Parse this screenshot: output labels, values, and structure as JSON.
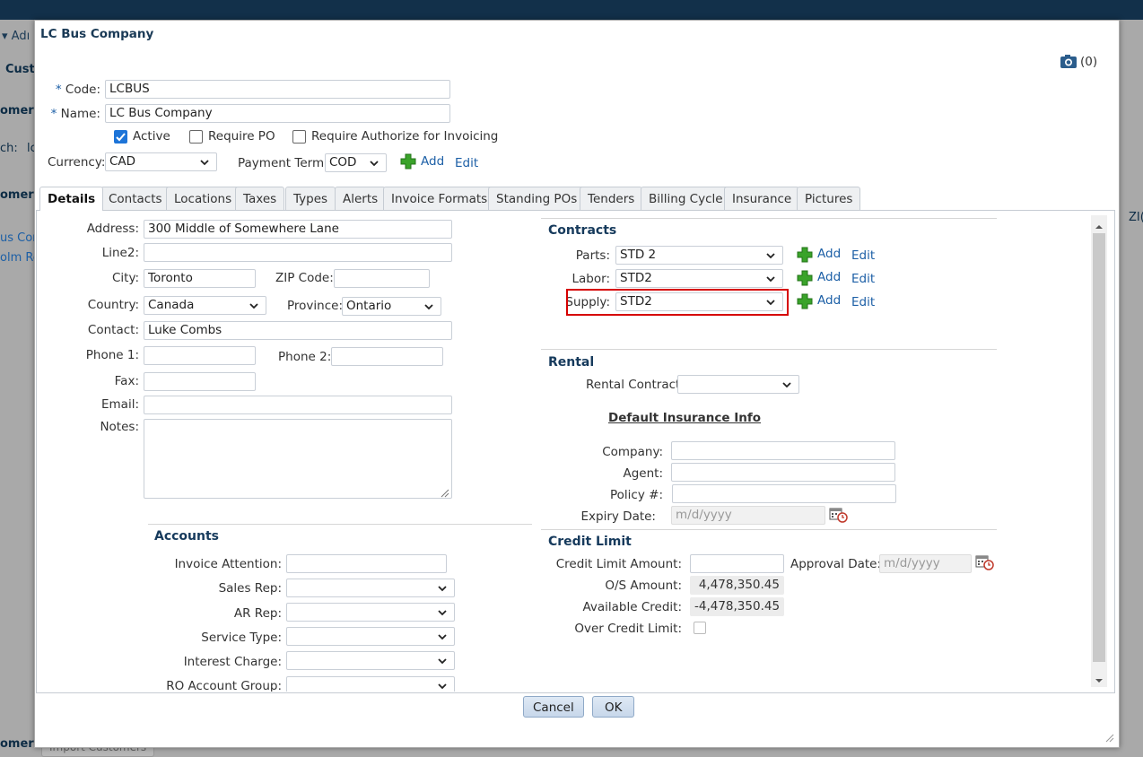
{
  "background": {
    "frag_adm": "Adı",
    "frag_cust": "Custo",
    "frag_omers": "omers",
    "frag_ch": "ch:",
    "frag_lc": "lc",
    "frag_omers2": "omers",
    "frag_zi": "ZI(",
    "frag_row1": "us Cor",
    "frag_row2": "olm Re",
    "frag_bottom": "omers",
    "import_label": "Import Customers"
  },
  "dialog": {
    "title": "LC Bus Company",
    "attachments_count": "(0)",
    "code_label": "Code:",
    "code_value": "LCBUS",
    "name_label": "Name:",
    "name_value": "LC Bus Company",
    "req_mark": "*",
    "active_label": "Active",
    "require_po_label": "Require PO",
    "require_auth_label": "Require Authorize for Invoicing",
    "currency_label": "Currency:",
    "currency_value": "CAD",
    "payment_term_label": "Payment Term:",
    "payment_term_value": "COD",
    "add_label": "Add",
    "edit_label": "Edit",
    "tabs": [
      "Details",
      "Contacts",
      "Locations",
      "Taxes",
      "Types",
      "Alerts",
      "Invoice Formats",
      "Standing POs",
      "Tenders",
      "Billing Cycle",
      "Insurance",
      "Pictures"
    ],
    "cancel_label": "Cancel",
    "ok_label": "OK"
  },
  "details": {
    "address_label": "Address:",
    "address_value": "300 Middle of Somewhere Lane",
    "line2_label": "Line2:",
    "city_label": "City:",
    "city_value": "Toronto",
    "zip_label": "ZIP Code:",
    "country_label": "Country:",
    "country_value": "Canada",
    "province_label": "Province:",
    "province_value": "Ontario",
    "contact_label": "Contact:",
    "contact_value": "Luke Combs",
    "phone1_label": "Phone 1:",
    "phone2_label": "Phone 2:",
    "fax_label": "Fax:",
    "email_label": "Email:",
    "notes_label": "Notes:"
  },
  "accounts": {
    "title": "Accounts",
    "invoice_attention_label": "Invoice Attention:",
    "sales_rep_label": "Sales Rep:",
    "ar_rep_label": "AR Rep:",
    "service_type_label": "Service Type:",
    "interest_charge_label": "Interest Charge:",
    "ro_account_group_label": "RO Account Group:"
  },
  "contracts": {
    "title": "Contracts",
    "parts_label": "Parts:",
    "parts_value": "STD 2",
    "labor_label": "Labor:",
    "labor_value": "STD2",
    "supply_label": "Supply:",
    "supply_value": "STD2",
    "add_label": "Add",
    "edit_label": "Edit"
  },
  "rental": {
    "title": "Rental",
    "rental_contract_label": "Rental Contract",
    "insurance_title": "Default Insurance Info",
    "company_label": "Company:",
    "agent_label": "Agent:",
    "policy_label": "Policy #:",
    "expiry_label": "Expiry Date:",
    "date_placeholder": "m/d/yyyy"
  },
  "credit": {
    "title": "Credit Limit",
    "amount_label": "Credit Limit Amount:",
    "approval_label": "Approval Date:",
    "date_placeholder": "m/d/yyyy",
    "os_label": "O/S Amount:",
    "os_value": "4,478,350.45",
    "available_label": "Available Credit:",
    "available_value": "-4,478,350.45",
    "over_label": "Over Credit Limit:"
  },
  "colors": {
    "accent": "#1c5fa6",
    "highlight": "#d60000",
    "section": "#163a5c"
  }
}
